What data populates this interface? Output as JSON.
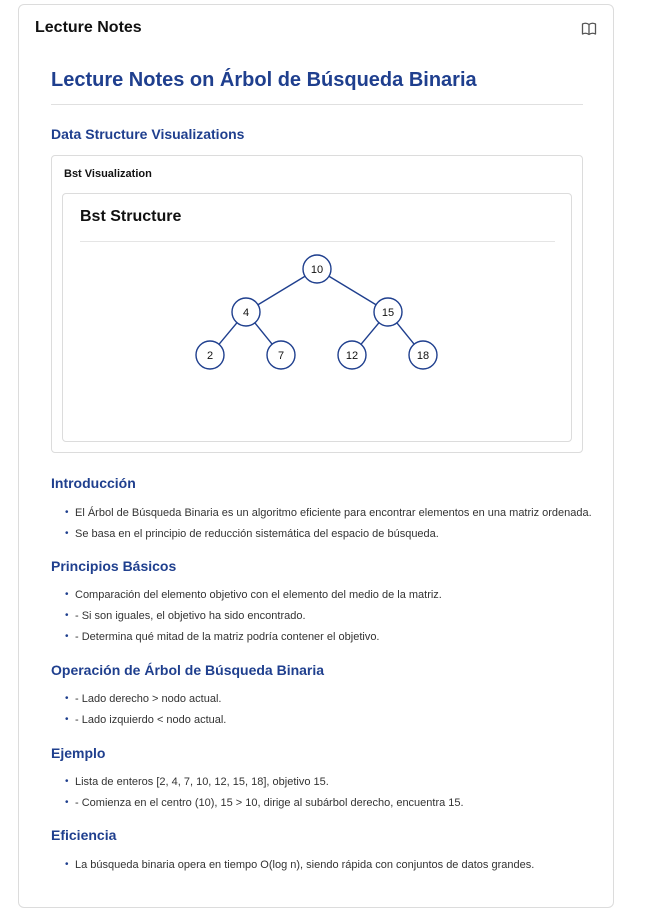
{
  "header": {
    "title": "Lecture Notes",
    "icon": "book-icon"
  },
  "page_title": "Lecture Notes on Árbol de Búsqueda Binaria",
  "viz_section": {
    "title": "Data Structure Visualizations",
    "box_label": "Bst Visualization",
    "inner_title": "Bst Structure"
  },
  "tree": {
    "nodes": [
      "10",
      "4",
      "15",
      "2",
      "7",
      "12",
      "18"
    ],
    "edges": [
      [
        0,
        1
      ],
      [
        0,
        2
      ],
      [
        1,
        3
      ],
      [
        1,
        4
      ],
      [
        2,
        5
      ],
      [
        2,
        6
      ]
    ],
    "stroke_color": "#1f3f8e"
  },
  "sections": [
    {
      "title": "Introducción",
      "items": [
        "El Árbol de Búsqueda Binaria es un algoritmo eficiente para encontrar elementos en una matriz ordenada.",
        "Se basa en el principio de reducción sistemática del espacio de búsqueda."
      ]
    },
    {
      "title": "Principios Básicos",
      "items": [
        "Comparación del elemento objetivo con el elemento del medio de la matriz.",
        "- Si son iguales, el objetivo ha sido encontrado.",
        "- Determina qué mitad de la matriz podría contener el objetivo."
      ]
    },
    {
      "title": "Operación de Árbol de Búsqueda Binaria",
      "items": [
        "- Lado derecho > nodo actual.",
        "- Lado izquierdo < nodo actual."
      ]
    },
    {
      "title": "Ejemplo",
      "items": [
        "Lista de enteros [2, 4, 7, 10, 12, 15, 18], objetivo 15.",
        "- Comienza en el centro (10), 15 > 10, dirige al subárbol derecho, encuentra 15."
      ]
    },
    {
      "title": "Eficiencia",
      "items": [
        "La búsqueda binaria opera en tiempo O(log n), siendo rápida con conjuntos de datos grandes."
      ]
    }
  ]
}
